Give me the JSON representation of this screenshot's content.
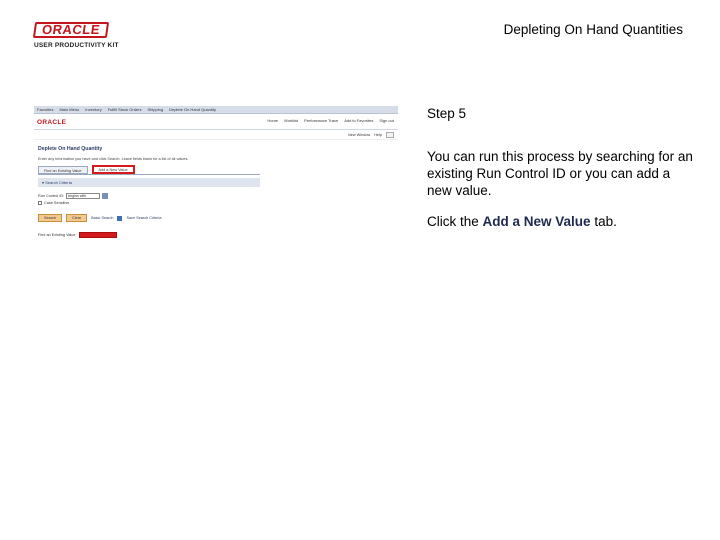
{
  "header": {
    "logo_brand": "ORACLE",
    "logo_product": "USER PRODUCTIVITY KIT",
    "doc_title": "Depleting On Hand Quantities"
  },
  "screenshot": {
    "menu_items": [
      "Favorites",
      "Main Menu",
      "Inventory",
      "Fulfill Stock Orders",
      "Shipping",
      "Deplete On Hand Quantity"
    ],
    "brand": "ORACLE",
    "top_links": [
      "Home",
      "Worklist",
      "Performance Trace",
      "Add to Favorites",
      "Sign out"
    ],
    "sub_links": [
      "New Window",
      "Help"
    ],
    "page_title": "Deplete On Hand Quantity",
    "instruction": "Enter any information you have and click Search. Leave fields blank for a list of all values.",
    "tabs": [
      "Find an Existing Value",
      "Add a New Value"
    ],
    "search_criteria": "Search Criteria",
    "field_label": "Run Control ID:",
    "field_value": "begins with",
    "case_sensitive": "Case Sensitive",
    "buttons": [
      "Search",
      "Clear"
    ],
    "links": [
      "Basic Search",
      "Save Search Criteria"
    ],
    "find_label": "Find an Existing Value"
  },
  "step": {
    "label": "Step 5",
    "description": "You can run this process by searching for an existing Run Control ID or you can add a new value.",
    "instruction_prefix": "Click the ",
    "instruction_target": "Add a New Value",
    "instruction_suffix": " tab."
  }
}
